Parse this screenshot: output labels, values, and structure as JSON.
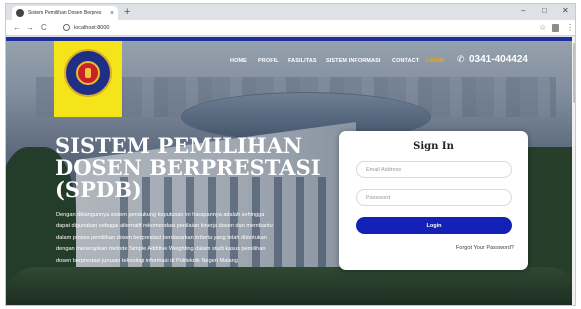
{
  "browser": {
    "tab_title": "Sistem Pemilihan Dosen Berpres",
    "tab_close": "×",
    "new_tab": "+",
    "url": "localhost:8000",
    "window_controls": {
      "minimize": "–",
      "maximize": "□",
      "close": "✕"
    },
    "nav": {
      "back": "←",
      "forward": "→",
      "reload": "C"
    },
    "star": "☆",
    "menu": "⋮"
  },
  "navbar": {
    "items": [
      {
        "label": "HOME",
        "active": false
      },
      {
        "label": "PROFIL",
        "active": false
      },
      {
        "label": "FASILITAS",
        "active": false
      },
      {
        "label": "SISTEM INFORMASI",
        "active": false
      },
      {
        "label": "CONTACT",
        "active": false
      },
      {
        "label": "LOGIN",
        "active": true
      }
    ],
    "phone_icon": "✆",
    "phone": "0341-404424"
  },
  "hero": {
    "title_lines": [
      "SISTEM PEMILIHAN",
      "DOSEN BERPRESTASI",
      "(SPDB)"
    ],
    "description_lines": [
      "Dengan dibangunnya sistem pendukung keputusan ini harapannya adalah sehingga",
      "dapat digunakan sebagai alternatif rekomendasi penilaian kinerja dosen dan membantu",
      "dalam proses pemilihan dosen berprestasi berdasarkan kriteria yang telah ditentukan",
      "dengan menerapkan metode Simple Additive Weighting dalam studi kasus pemilihan",
      "dosen berprestasi jurusan teknologi informasi di Politeknik Negeri Malang"
    ]
  },
  "signin": {
    "title": "Sign In",
    "email_placeholder": "Email Address",
    "email_value": "",
    "password_placeholder": "Password",
    "password_value": "",
    "login_label": "Login",
    "forgot_label": "Forgot Your Password?"
  },
  "colors": {
    "brand_blue": "#1421b6",
    "accent_orange": "#f5a51b",
    "logo_yellow": "#f6e41a"
  },
  "icons": {
    "tab": "globe-icon",
    "logo": "polinema-seal-logo",
    "phone": "phone-icon",
    "info": "info-icon",
    "extension": "extension-icon"
  }
}
